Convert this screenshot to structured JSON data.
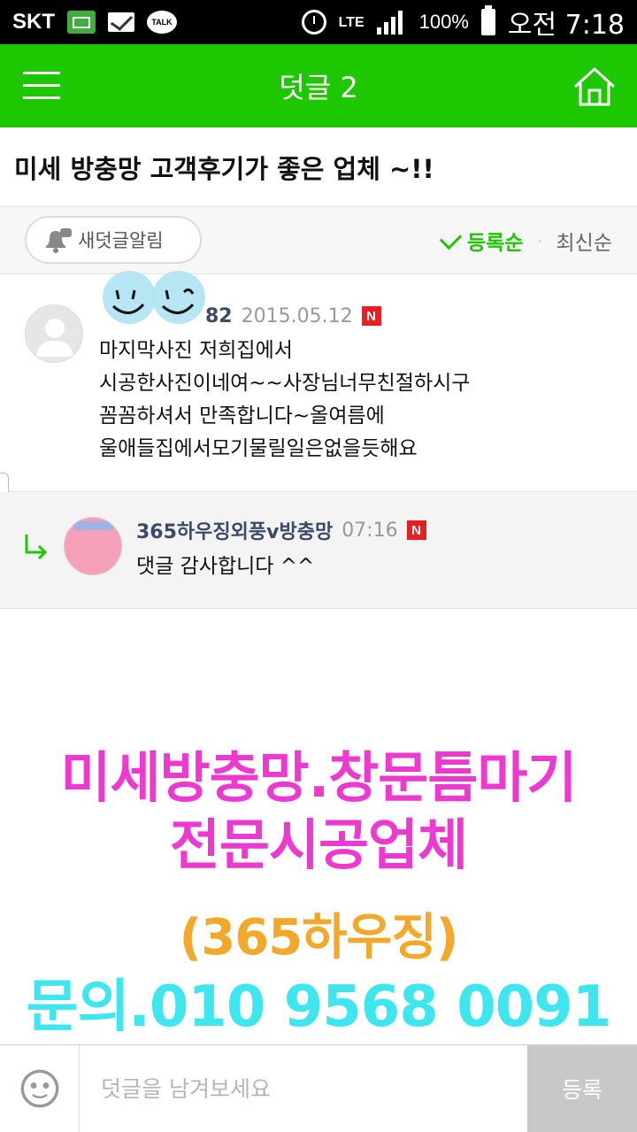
{
  "status_bar": {
    "carrier": "SKT",
    "talk_label": "TALK",
    "network": "LTE",
    "battery": "100%",
    "time": "오전 7:18"
  },
  "header": {
    "title": "덧글 2",
    "left_icon": "menu-icon",
    "right_icon": "home-icon",
    "color": "#1ec800"
  },
  "post": {
    "title": "미세 방충망 고객후기가 좋은 업체 ~!!"
  },
  "controls": {
    "notify_label": "새덧글알림",
    "sort_active": "등록순",
    "sort_other": "최신순"
  },
  "comments": [
    {
      "author": "82",
      "date": "2015.05.12",
      "badge": "N",
      "body": "마지막사진 저희집에서\n시공한사진이네여~~사장님너무친절하시구\n꼼꼼하셔서 만족합니다~올여름에\n울애들집에서모기물릴일은없을듯해요"
    }
  ],
  "reply": {
    "author": "365하우징외풍v방충망",
    "time": "07:16",
    "badge": "N",
    "body": "댓글 감사합니다 ^^"
  },
  "overlay": {
    "line1": "미세방충망.창문틈마기",
    "line2": "전문시공업체",
    "line3": "(365하우징)",
    "line4": "문의.010 9568 0091",
    "colors": {
      "pink": "#ec3ad0",
      "orange": "#f3a82a",
      "cyan": "#3ee6f0"
    }
  },
  "input_bar": {
    "placeholder": "덧글을 남겨보세요",
    "submit_label": "등록"
  }
}
